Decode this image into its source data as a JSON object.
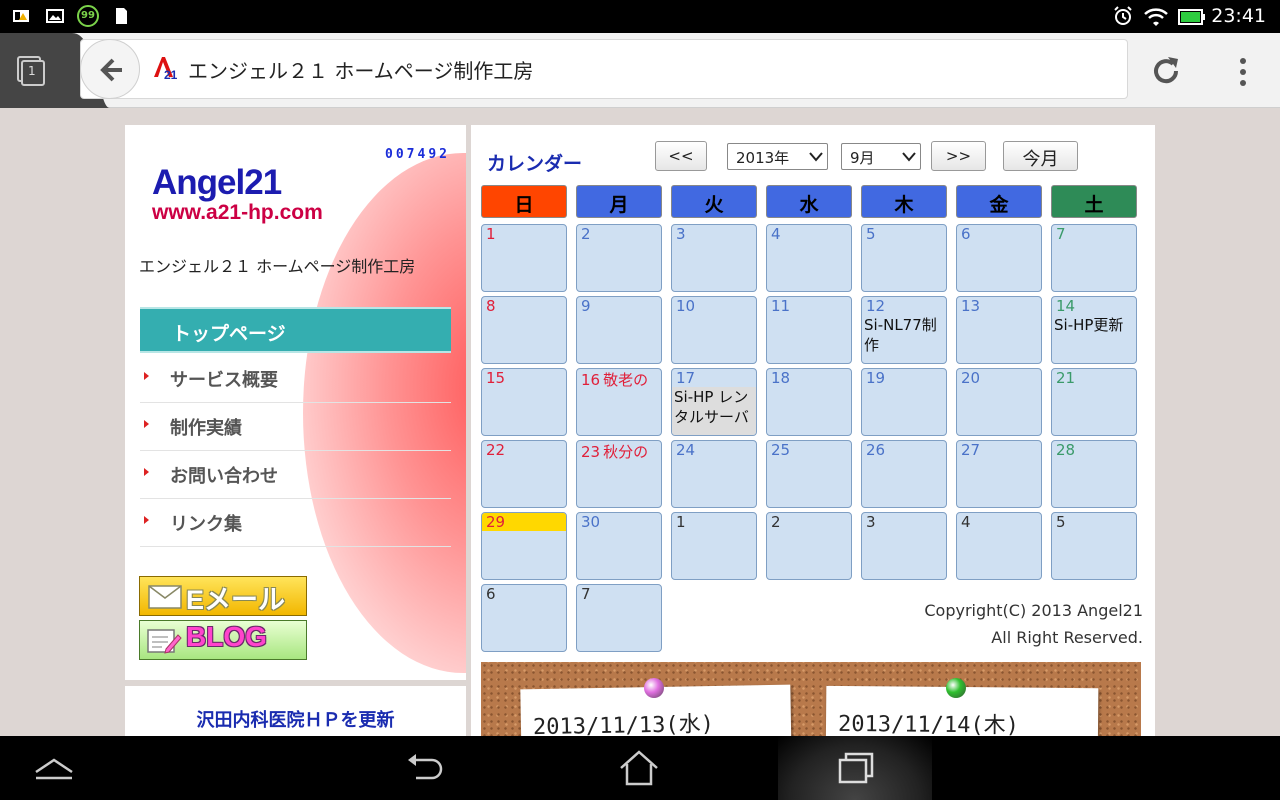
{
  "statusbar": {
    "time": "23:41",
    "badge": "99"
  },
  "browser": {
    "tab_count": "1",
    "url_title": "エンジェル２１ ホームページ制作工房",
    "favicon_text": "21"
  },
  "sidebar": {
    "counter": "007492",
    "logo_line1": "Angel21",
    "logo_line2": "www.a21-hp.com",
    "site_name": "エンジェル２１ ホームページ制作工房",
    "nav": [
      {
        "label": "トップページ"
      },
      {
        "label": "サービス概要"
      },
      {
        "label": "制作実績"
      },
      {
        "label": "お問い合わせ"
      },
      {
        "label": "リンク集"
      }
    ],
    "email_label": "Eメール",
    "blog_label": "BLOG",
    "news_title": "沢田内科医院ＨＰを更新"
  },
  "calendar": {
    "title": "カレンダー",
    "prev_label": "<<",
    "next_label": ">>",
    "year_value": "2013年",
    "month_value": "9月",
    "today_label": "今月",
    "weekdays": [
      "日",
      "月",
      "火",
      "水",
      "木",
      "金",
      "土"
    ],
    "weekday_colors": [
      "#ff4500",
      "#4169e1",
      "#4169e1",
      "#4169e1",
      "#4169e1",
      "#4169e1",
      "#2e8b57"
    ],
    "weeks": [
      [
        {
          "d": "1"
        },
        {
          "d": "2"
        },
        {
          "d": "3"
        },
        {
          "d": "4"
        },
        {
          "d": "5"
        },
        {
          "d": "6"
        },
        {
          "d": "7"
        }
      ],
      [
        {
          "d": "8"
        },
        {
          "d": "9"
        },
        {
          "d": "10"
        },
        {
          "d": "11"
        },
        {
          "d": "12",
          "ev": "Si-NL77制作"
        },
        {
          "d": "13"
        },
        {
          "d": "14",
          "ev": "Si-HP更新"
        }
      ],
      [
        {
          "d": "15"
        },
        {
          "d": "16",
          "hol": "敬老の"
        },
        {
          "d": "17",
          "ev": "Si-HP レンタルサーバー"
        },
        {
          "d": "18"
        },
        {
          "d": "19"
        },
        {
          "d": "20"
        },
        {
          "d": "21"
        }
      ],
      [
        {
          "d": "22"
        },
        {
          "d": "23",
          "hol": "秋分の"
        },
        {
          "d": "24"
        },
        {
          "d": "25"
        },
        {
          "d": "26"
        },
        {
          "d": "27"
        },
        {
          "d": "28"
        }
      ],
      [
        {
          "d": "29",
          "today": true
        },
        {
          "d": "30"
        },
        {
          "d": "1",
          "other": true
        },
        {
          "d": "2",
          "other": true
        },
        {
          "d": "3",
          "other": true
        },
        {
          "d": "4",
          "other": true
        },
        {
          "d": "5",
          "other": true
        }
      ],
      [
        {
          "d": "6",
          "other": true
        },
        {
          "d": "7",
          "other": true
        }
      ]
    ],
    "copyright_line1": "Copyright(C) 2013 Angel21",
    "copyright_line2": "All Right Reserved."
  },
  "notes": [
    {
      "text": "2013/11/13(水)",
      "pin_color": "#e070e0"
    },
    {
      "text": "2013/11/14(木)",
      "pin_color": "#30c030"
    }
  ]
}
